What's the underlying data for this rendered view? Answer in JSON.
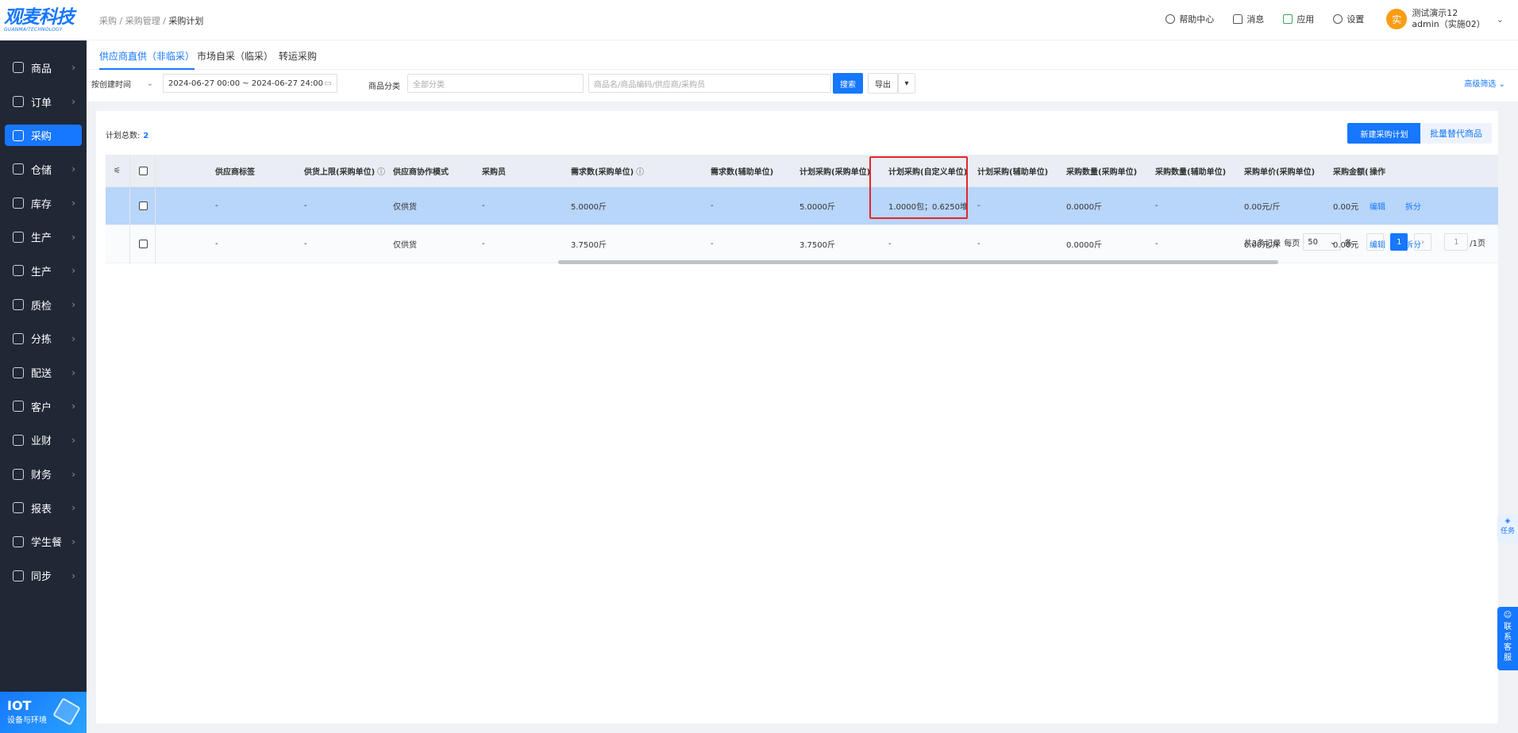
{
  "brand": {
    "name_cn": "观麦科技",
    "name_en": "GUANMAITECHNOLOGY"
  },
  "sidebar": {
    "items": [
      {
        "label": "商品",
        "icon": "grid-icon"
      },
      {
        "label": "订单",
        "icon": "clipboard-icon"
      },
      {
        "label": "采购",
        "icon": "basket-icon",
        "active": true
      },
      {
        "label": "仓储",
        "icon": "warehouse-icon"
      },
      {
        "label": "库存",
        "icon": "stock-icon"
      },
      {
        "label": "生产",
        "icon": "factory-icon"
      },
      {
        "label": "生产",
        "icon": "factory-icon"
      },
      {
        "label": "质检",
        "icon": "shield-icon"
      },
      {
        "label": "分拣",
        "icon": "sort-icon"
      },
      {
        "label": "配送",
        "icon": "truck-icon"
      },
      {
        "label": "客户",
        "icon": "user-icon"
      },
      {
        "label": "业财",
        "icon": "chart-icon"
      },
      {
        "label": "财务",
        "icon": "wallet-icon"
      },
      {
        "label": "报表",
        "icon": "report-icon"
      },
      {
        "label": "学生餐",
        "icon": "meal-icon"
      },
      {
        "label": "同步",
        "icon": "sync-icon"
      }
    ],
    "iot": {
      "title": "IOT",
      "subtitle": "设备与环境"
    }
  },
  "topbar": {
    "breadcrumb": [
      "采购",
      "采购管理",
      "采购计划"
    ],
    "links": [
      {
        "label": "帮助中心",
        "icon": "help-icon"
      },
      {
        "label": "消息",
        "icon": "bell-icon"
      },
      {
        "label": "应用",
        "icon": "app-icon"
      },
      {
        "label": "设置",
        "icon": "gear-icon"
      }
    ],
    "user": {
      "avatar": "实",
      "name": "测试演示12",
      "account": "admin（实施02）"
    }
  },
  "tabs": [
    "供应商直供（非临采）",
    "市场自采（临采）",
    "转运采购"
  ],
  "filter": {
    "time_type": "按创建时间",
    "date_range": "2024-06-27 00:00 ~ 2024-06-27 24:00",
    "category_label": "商品分类",
    "category_placeholder": "全部分类",
    "search_placeholder": "商品名/商品编码/供应商/采购员",
    "search_button": "搜索",
    "export_button": "导出",
    "advanced": "高级筛选"
  },
  "summary": {
    "label": "计划总数:",
    "count": "2"
  },
  "actions": {
    "new_plan": "新建采购计划",
    "bulk_replace": "批量替代商品"
  },
  "table": {
    "headers": [
      "供应商标签",
      "供货上限(采购单位)",
      "供应商协作模式",
      "采购员",
      "需求数(采购单位)",
      "需求数(辅助单位)",
      "计划采购(采购单位)",
      "计划采购(自定义单位)",
      "计划采购(辅助单位)",
      "采购数量(采购单位)",
      "采购数量(辅助单位)",
      "采购单价(采购单位)",
      "采购金额(",
      "操作"
    ],
    "rows": [
      [
        "-",
        "-",
        "仅供货",
        "-",
        "5.0000斤",
        "-",
        "5.0000斤",
        "1.0000包；0.6250堆",
        "-",
        "0.0000斤",
        "-",
        "0.00元/斤",
        "0.00元"
      ],
      [
        "-",
        "-",
        "仅供货",
        "-",
        "3.7500斤",
        "-",
        "3.7500斤",
        "-",
        "-",
        "0.0000斤",
        "-",
        "0.00元/斤",
        "0.00元"
      ]
    ],
    "row_actions": {
      "edit": "编辑",
      "split": "拆分"
    }
  },
  "pagination": {
    "total": "共2条记录",
    "per_page_label": "每页",
    "per_page": "50",
    "unit": "条",
    "current": "1",
    "jump": "1",
    "pages": "/1页"
  },
  "floating": {
    "task": "任务",
    "service": "联系客服"
  },
  "colors": {
    "primary": "#1677ff",
    "sidebar": "#202836",
    "highlight_border": "#e5242b",
    "selected_row": "#b8d5fa"
  }
}
